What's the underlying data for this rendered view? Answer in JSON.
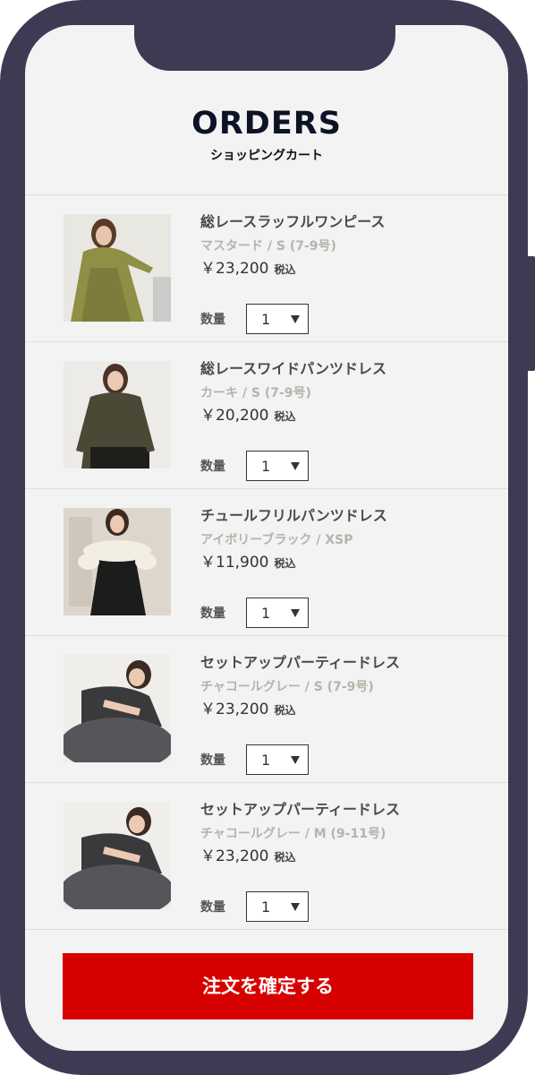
{
  "header": {
    "title": "ORDERS",
    "subtitle": "ショッピングカート"
  },
  "cart": {
    "quantity_label": "数量",
    "tax_label": "税込",
    "items": [
      {
        "name": "総レースラッフルワンピース",
        "variant": "マスタード / S (7-9号)",
        "price": "￥23,200",
        "quantity": "1",
        "image_colors": {
          "background": "#e9e7e1",
          "garment": "#8f8f45",
          "accent": "#6f6e36"
        }
      },
      {
        "name": "総レースワイドパンツドレス",
        "variant": "カーキ / S (7-9号)",
        "price": "￥20,200",
        "quantity": "1",
        "image_colors": {
          "background": "#ecebe8",
          "garment": "#4b4836",
          "accent": "#1f1e1a"
        }
      },
      {
        "name": "チュールフリルパンツドレス",
        "variant": "アイボリーブラック / XSP",
        "price": "￥11,900",
        "quantity": "1",
        "image_colors": {
          "background": "#ddd6cc",
          "garment": "#1c1c1c",
          "accent": "#f2eee4"
        }
      },
      {
        "name": "セットアップパーティードレス",
        "variant": "チャコールグレー / S (7-9号)",
        "price": "￥23,200",
        "quantity": "1",
        "image_colors": {
          "background": "#efeeeb",
          "garment": "#3a3a3c",
          "accent": "#56565a"
        }
      },
      {
        "name": "セットアップパーティードレス",
        "variant": "チャコールグレー / M (9-11号)",
        "price": "￥23,200",
        "quantity": "1",
        "image_colors": {
          "background": "#efeeeb",
          "garment": "#3a3a3c",
          "accent": "#56565a"
        }
      }
    ]
  },
  "actions": {
    "confirm_label": "注文を確定する"
  },
  "colors": {
    "frame": "#3d3b54",
    "screen_background": "#f3f3f3",
    "confirm_button": "#d70000",
    "variant_text": "#b7b3ab"
  }
}
